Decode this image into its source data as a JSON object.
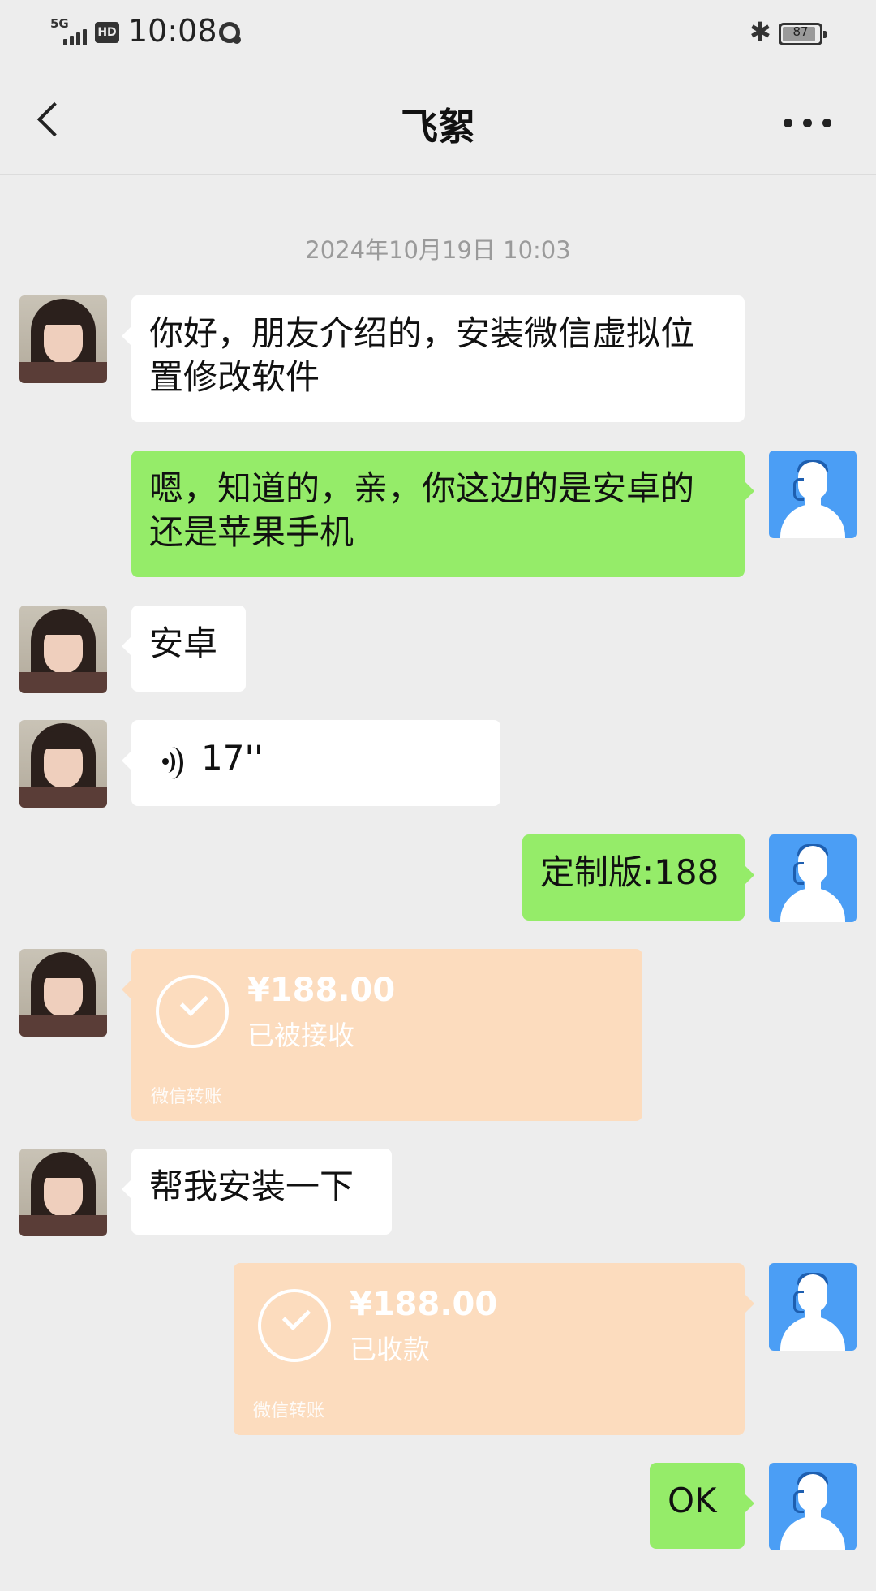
{
  "status_bar": {
    "network": "5G",
    "hd": "HD",
    "time": "10:08",
    "battery": "87"
  },
  "header": {
    "title": "飞絮"
  },
  "timestamp": "2024年10月19日 10:03",
  "messages": [
    {
      "side": "left",
      "type": "text",
      "text": "你好，朋友介绍的，安装微信虚拟位置修改软件"
    },
    {
      "side": "right",
      "type": "text",
      "text": "嗯，知道的，亲，你这边的是安卓的还是苹果手机"
    },
    {
      "side": "left",
      "type": "text",
      "text": "安卓"
    },
    {
      "side": "left",
      "type": "voice",
      "duration": "17''"
    },
    {
      "side": "right",
      "type": "text",
      "text": "定制版:188"
    },
    {
      "side": "left",
      "type": "transfer",
      "amount": "¥188.00",
      "status": "已被接收",
      "label": "微信转账"
    },
    {
      "side": "left",
      "type": "text",
      "text": "帮我安装一下"
    },
    {
      "side": "right",
      "type": "transfer",
      "amount": "¥188.00",
      "status": "已收款",
      "label": "微信转账"
    },
    {
      "side": "right",
      "type": "text",
      "text": "OK"
    }
  ]
}
